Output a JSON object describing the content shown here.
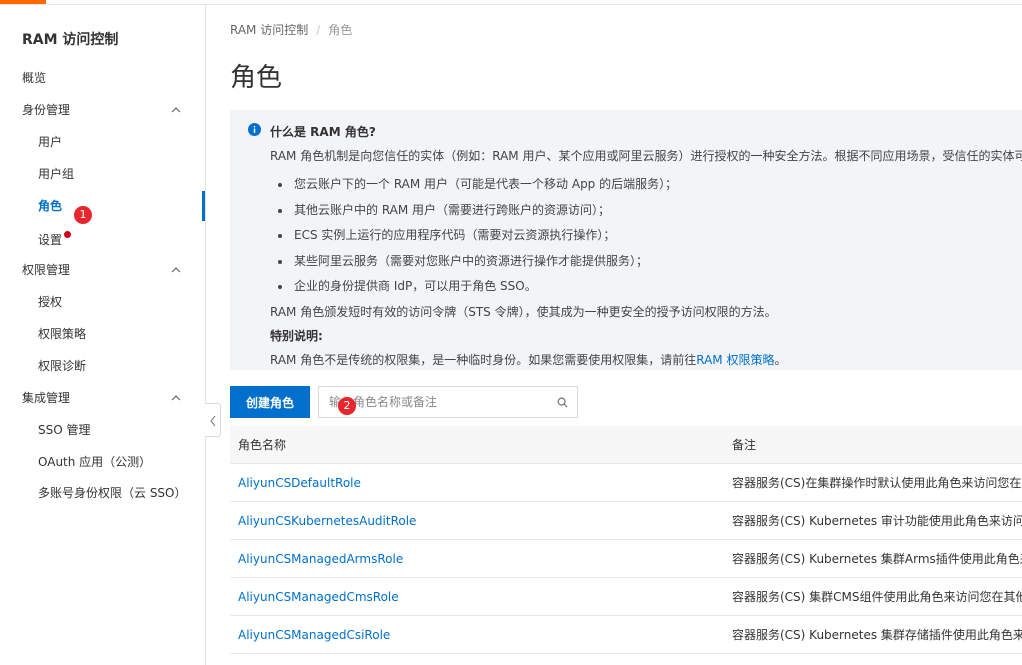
{
  "sidebar": {
    "title": "RAM 访问控制",
    "items": [
      {
        "label": "概览"
      },
      {
        "label": "身份管理"
      },
      {
        "label": "用户"
      },
      {
        "label": "用户组"
      },
      {
        "label": "角色"
      },
      {
        "label": "设置"
      },
      {
        "label": "权限管理"
      },
      {
        "label": "授权"
      },
      {
        "label": "权限策略"
      },
      {
        "label": "权限诊断"
      },
      {
        "label": "集成管理"
      },
      {
        "label": "SSO 管理"
      },
      {
        "label": "OAuth 应用（公测）"
      },
      {
        "label": "多账号身份权限（云 SSO）"
      }
    ]
  },
  "badges": {
    "one": "1",
    "two": "2"
  },
  "breadcrumb": {
    "root": "RAM 访问控制",
    "separator": "/",
    "current": "角色"
  },
  "page": {
    "title": "角色"
  },
  "info": {
    "title": "什么是 RAM 角色?",
    "desc": "RAM 角色机制是向您信任的实体（例如：RAM 用户、某个应用或阿里云服务）进行授权的一种安全方法。根据不同应用场景，受信任的实体可能有",
    "bullets": [
      "您云账户下的一个 RAM 用户（可能是代表一个移动 App 的后端服务）；",
      "其他云账户中的 RAM 用户（需要进行跨账户的资源访问）；",
      "ECS 实例上运行的应用程序代码（需要对云资源执行操作）；",
      "某些阿里云服务（需要对您账户中的资源进行操作才能提供服务）；",
      "企业的身份提供商 IdP，可以用于角色 SSO。"
    ],
    "p2": "RAM 角色颁发短时有效的访问令牌（STS 令牌），使其成为一种更安全的授予访问权限的方法。",
    "p3": "特别说明:",
    "p4_text": "RAM 角色不是传统的权限集，是一种临时身份。如果您需要使用权限集，请前往",
    "p4_link": "RAM 权限策略",
    "p4_end": "。"
  },
  "toolbar": {
    "create_label": "创建角色",
    "search_placeholder": "输入角色名称或备注"
  },
  "table": {
    "headers": {
      "name": "角色名称",
      "remark": "备注"
    },
    "rows": [
      {
        "name": "AliyunCSDefaultRole",
        "remark": "容器服务(CS)在集群操作时默认使用此角色来访问您在其他云产品"
      },
      {
        "name": "AliyunCSKubernetesAuditRole",
        "remark": "容器服务(CS) Kubernetes 审计功能使用此角色来访问您在其他云产品"
      },
      {
        "name": "AliyunCSManagedArmsRole",
        "remark": "容器服务(CS) Kubernetes 集群Arms插件使用此角色来访问您在其他"
      },
      {
        "name": "AliyunCSManagedCmsRole",
        "remark": "容器服务(CS) 集群CMS组件使用此角色来访问您在其他云产品中的资源"
      },
      {
        "name": "AliyunCSManagedCsiRole",
        "remark": "容器服务(CS) Kubernetes 集群存储插件使用此角色来访问您在其他"
      }
    ]
  }
}
